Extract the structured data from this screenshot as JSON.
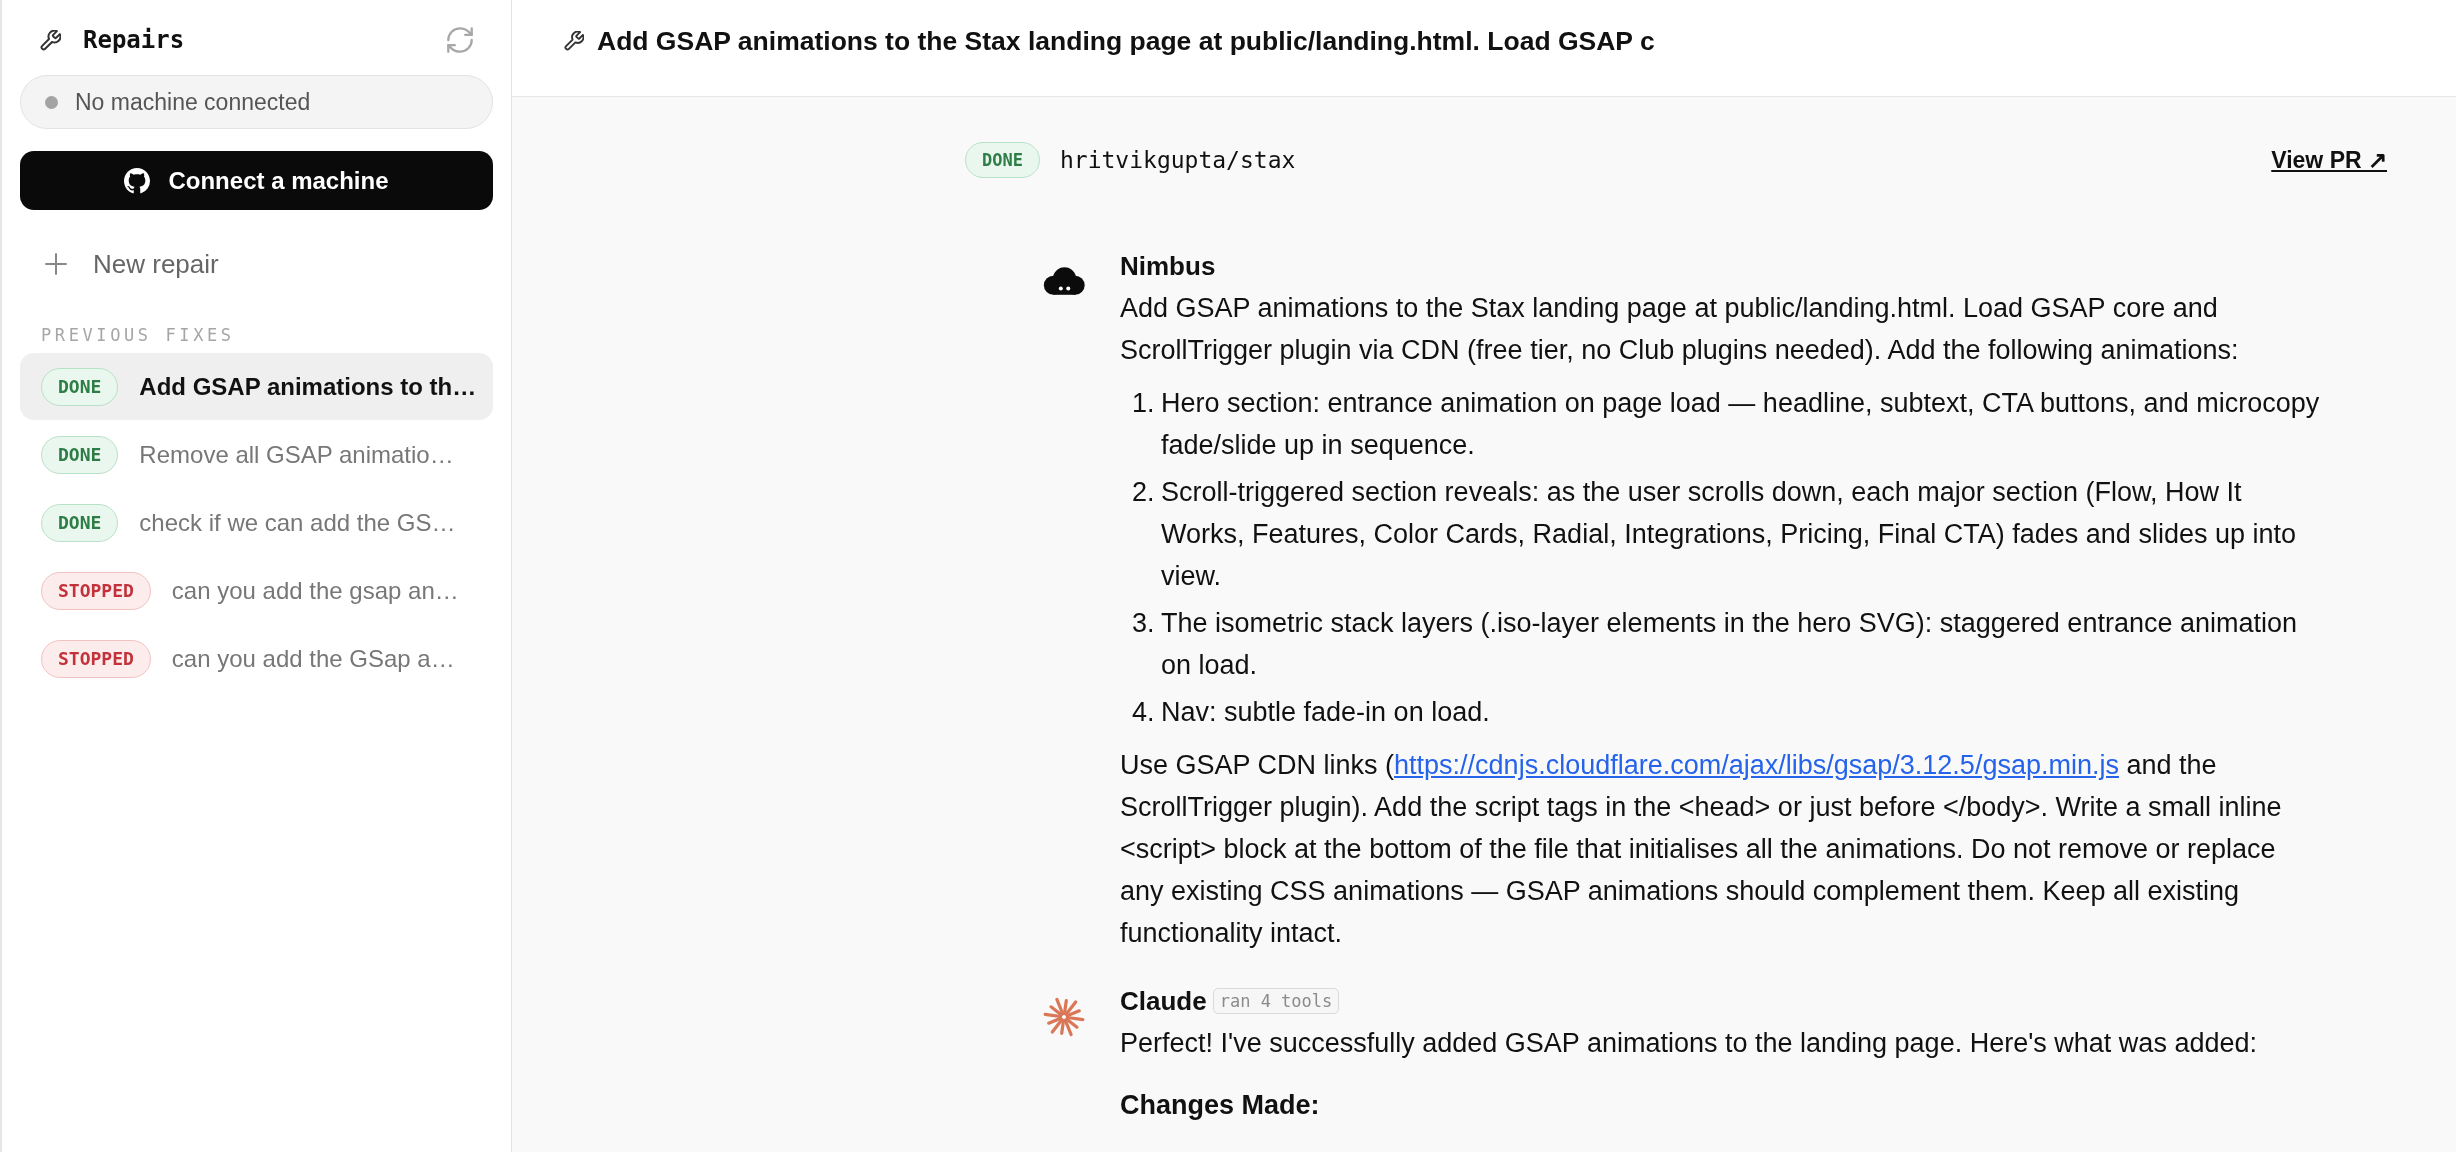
{
  "sidebar": {
    "title": "Repairs",
    "machine_status": {
      "text": "No machine connected",
      "connected": false
    },
    "connect_button": "Connect a machine",
    "new_repair": "New repair",
    "section_label": "PREVIOUS FIXES",
    "items": [
      {
        "status": "DONE",
        "kind": "done",
        "title": "Add GSAP animations to th…",
        "selected": true
      },
      {
        "status": "DONE",
        "kind": "done",
        "title": "Remove all GSAP animatio…",
        "selected": false
      },
      {
        "status": "DONE",
        "kind": "done",
        "title": "check if we can add the GS…",
        "selected": false
      },
      {
        "status": "STOPPED",
        "kind": "stopped",
        "title": "can you add the gsap an…",
        "selected": false
      },
      {
        "status": "STOPPED",
        "kind": "stopped",
        "title": "can you add the GSap a…",
        "selected": false
      }
    ]
  },
  "main": {
    "title": "Add GSAP animations to the Stax landing page at public/landing.html. Load GSAP c",
    "repo": {
      "status": "DONE",
      "kind": "done",
      "name": "hritvikgupta/stax",
      "link": "View PR ↗"
    },
    "messages": [
      {
        "kind": "user",
        "author": "Nimbus",
        "blocks": [
          {
            "kind": "paragraph",
            "parts": [
              {
                "kind": "text",
                "text": "Add GSAP animations to the Stax landing page at public/landing.html. Load GSAP core and ScrollTrigger plugin via CDN (free tier, no Club plugins needed). Add the following animations:"
              }
            ]
          },
          {
            "kind": "list",
            "items": [
              {
                "marker": "1.",
                "text": "Hero section: entrance animation on page load — headline, subtext, CTA buttons, and microcopy fade/slide up in sequence."
              },
              {
                "marker": "2.",
                "text": "Scroll-triggered section reveals: as the user scrolls down, each major section (Flow, How It Works, Features, Color Cards, Radial, Integrations, Pricing, Final CTA) fades and slides up into view."
              },
              {
                "marker": "3.",
                "text": "The isometric stack layers (.iso-layer elements in the hero SVG): staggered entrance animation on load."
              },
              {
                "marker": "4.",
                "text": "Nav: subtle fade-in on load."
              }
            ]
          },
          {
            "kind": "paragraph",
            "parts": [
              {
                "kind": "text",
                "text": "Use GSAP CDN links ("
              },
              {
                "kind": "link",
                "text": "https://cdnjs.cloudflare.com/ajax/libs/gsap/3.12.5/gsap.min.js"
              },
              {
                "kind": "text",
                "text": " and the ScrollTrigger plugin). Add the script tags in the <head> or just before </body>. Write a small inline <script> block at the bottom of the file that initialises all the animations. Do not remove or replace any existing CSS animations — GSAP animations should complement them. Keep all existing functionality intact."
              }
            ]
          }
        ]
      },
      {
        "kind": "assistant",
        "author": "Claude",
        "tools_badge": "ran 4 tools",
        "blocks": [
          {
            "kind": "paragraph",
            "parts": [
              {
                "kind": "text",
                "text": "Perfect! I've successfully added GSAP animations to the landing page. Here's what was added:"
              }
            ]
          },
          {
            "kind": "heading",
            "text": "Changes Made:"
          }
        ]
      }
    ]
  }
}
